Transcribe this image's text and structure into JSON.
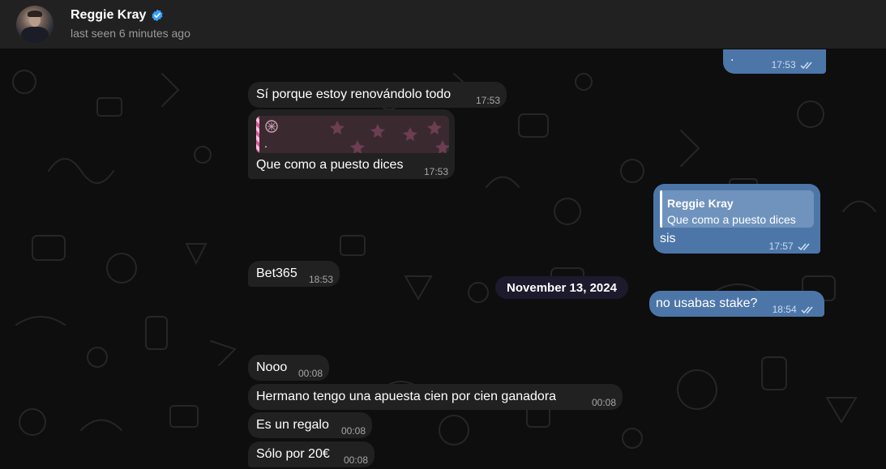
{
  "header": {
    "contact_name": "Reggie Kray",
    "last_seen": "last seen 6 minutes ago",
    "verified_icon": "verified-check-icon",
    "accent": "#3aa0ff"
  },
  "messages": [
    {
      "id": "m0",
      "dir": "out",
      "text": ".",
      "time": "17:53",
      "read": true
    },
    {
      "id": "m1",
      "dir": "in",
      "text": "Sí porque estoy renovándolo todo",
      "time": "17:53"
    },
    {
      "id": "m2",
      "dir": "in",
      "reply_preview": ".",
      "reply_icon": "sticker-icon",
      "text": "Que como a puesto dices",
      "time": "17:53"
    },
    {
      "id": "m3",
      "dir": "out",
      "reply_author": "Reggie Kray",
      "reply_text": "Que como a puesto dices",
      "text": "sis",
      "time": "17:57",
      "read": true
    },
    {
      "id": "m4",
      "dir": "in",
      "text": "Bet365",
      "time": "18:53"
    },
    {
      "id": "m5",
      "dir": "out",
      "text": "no usabas stake?",
      "time": "18:54",
      "read": true
    },
    {
      "id": "m6",
      "dir": "in",
      "text": "Nooo",
      "time": "00:08"
    },
    {
      "id": "m7",
      "dir": "in",
      "text": "Hermano tengo una apuesta cien por cien ganadora",
      "time": "00:08"
    },
    {
      "id": "m8",
      "dir": "in",
      "text": "Es un regalo",
      "time": "00:08"
    },
    {
      "id": "m9",
      "dir": "in",
      "text": "Sólo por 20€",
      "time": "00:08"
    }
  ],
  "date_separator": "November 13, 2024",
  "colors": {
    "incoming_bubble": "#212121",
    "outgoing_bubble": "#4d76a8",
    "background": "#0e0e0e"
  }
}
